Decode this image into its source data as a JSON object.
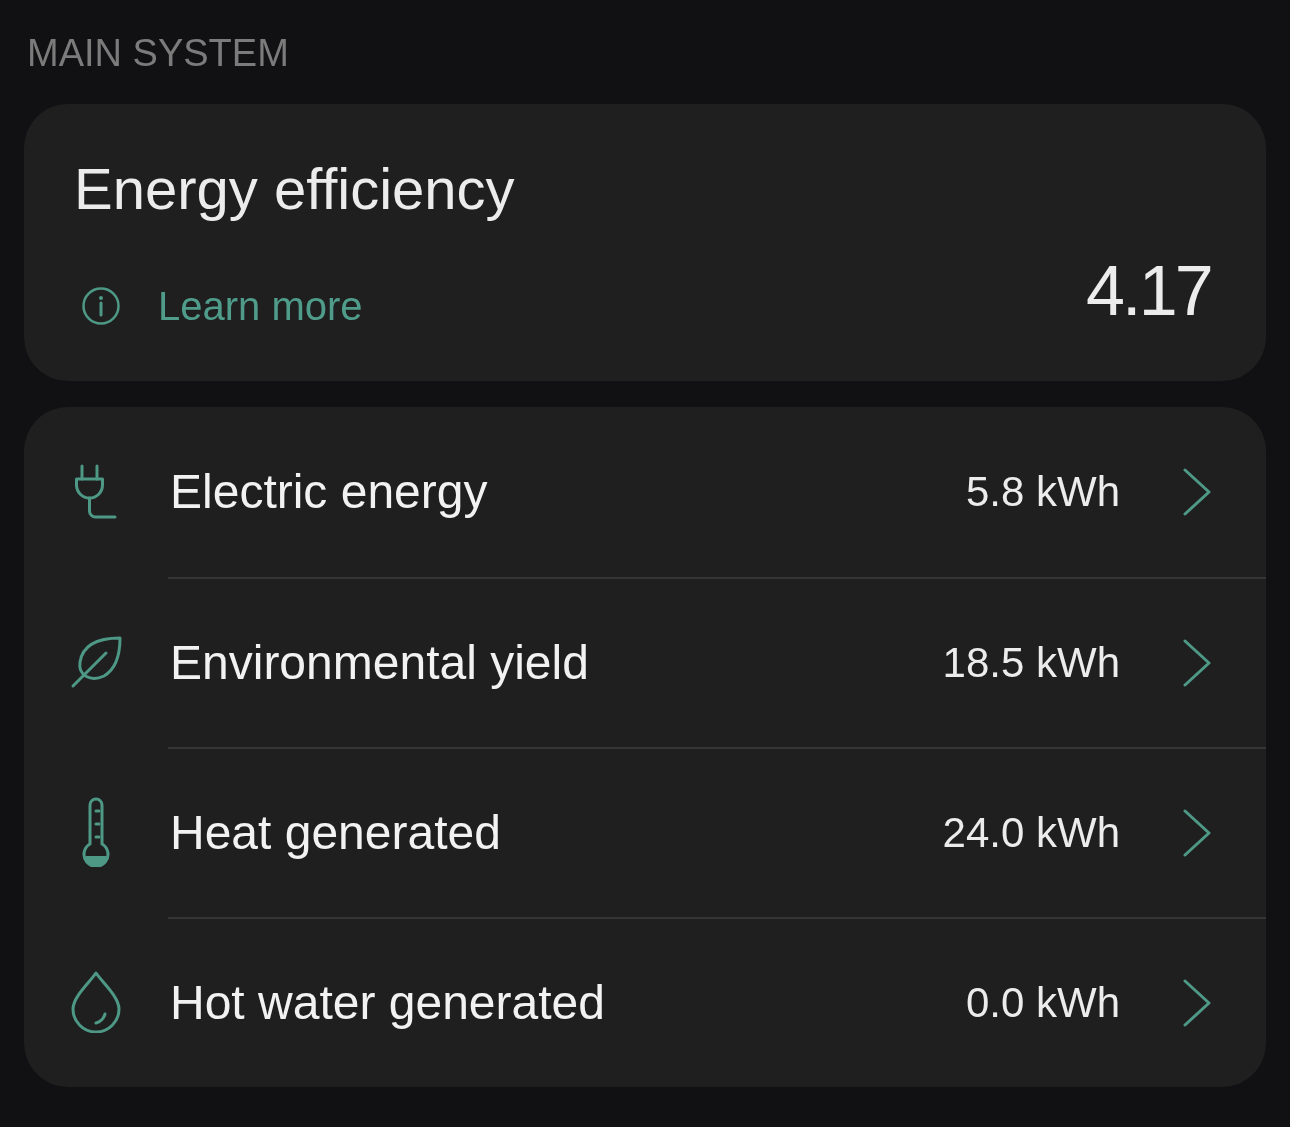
{
  "section": {
    "title": "MAIN SYSTEM"
  },
  "efficiency_card": {
    "title": "Energy efficiency",
    "link": "Learn more",
    "value": "4.17"
  },
  "items": [
    {
      "kind": "plug",
      "label": "Electric energy",
      "value": "5.8 kWh"
    },
    {
      "kind": "leaf",
      "label": "Environmental yield",
      "value": "18.5 kWh"
    },
    {
      "kind": "thermometer",
      "label": "Heat generated",
      "value": "24.0 kWh"
    },
    {
      "kind": "drop",
      "label": "Hot water generated",
      "value": "0.0 kWh"
    }
  ]
}
